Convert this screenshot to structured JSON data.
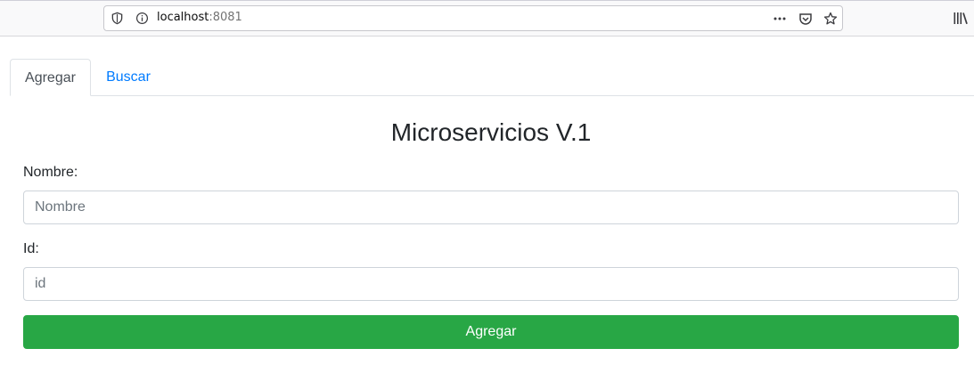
{
  "browser": {
    "url_host": "localhost",
    "url_port": ":8081",
    "icons": [
      "shield-icon",
      "info-icon",
      "more-actions-icon",
      "pocket-icon",
      "bookmark-star-icon",
      "library-icon"
    ]
  },
  "tabs": [
    {
      "label": "Agregar",
      "active": true
    },
    {
      "label": "Buscar",
      "active": false
    }
  ],
  "main": {
    "title": "Microservicios V.1",
    "form": {
      "name_label": "Nombre:",
      "name_placeholder": "Nombre",
      "name_value": "",
      "id_label": "Id:",
      "id_placeholder": "id",
      "id_value": "",
      "submit_label": "Agregar"
    }
  },
  "colors": {
    "accent_link": "#007bff",
    "success_button": "#28a745"
  }
}
